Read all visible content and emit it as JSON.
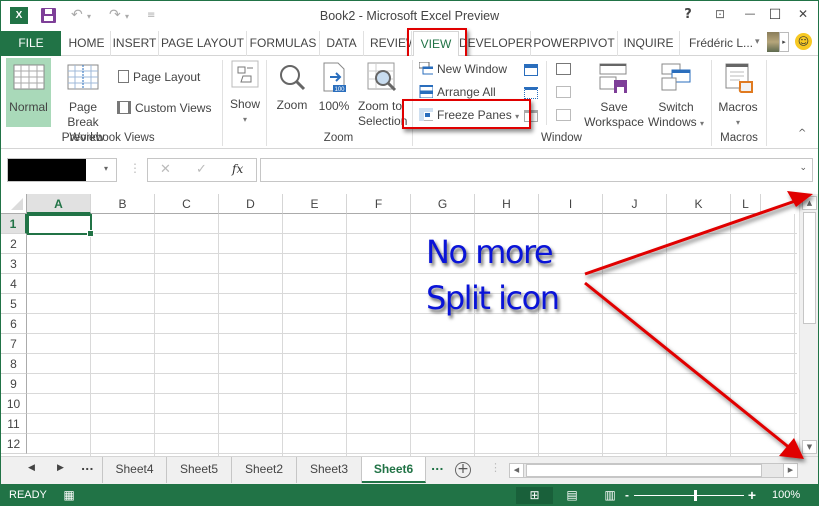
{
  "window": {
    "title": "Book2 - Microsoft Excel Preview",
    "app_icon": "excel-logo-icon",
    "qat": [
      "save-icon",
      "undo-icon",
      "redo-icon",
      "customize-qat-icon"
    ],
    "controls": {
      "help": "?",
      "restore_ribbon": "⊡",
      "minimize": "—",
      "maximize": "☐",
      "close": "✕"
    }
  },
  "tabs": {
    "file": "FILE",
    "items": [
      "HOME",
      "INSERT",
      "PAGE LAYOUT",
      "FORMULAS",
      "DATA",
      "REVIEW",
      "VIEW",
      "DEVELOPER",
      "POWERPIVOT",
      "INQUIRE"
    ],
    "active": "VIEW",
    "user": "Frédéric L...",
    "user_dropdown": "▾",
    "smiley": "☺"
  },
  "ribbon": {
    "workbook_views": {
      "label": "Workbook Views",
      "normal": "Normal",
      "page_break_1": "Page Break",
      "page_break_2": "Preview",
      "page_layout": "Page Layout",
      "custom_views": "Custom Views"
    },
    "show": {
      "label": "Show",
      "arrow": "▾"
    },
    "zoom": {
      "label": "Zoom",
      "zoom": "Zoom",
      "hundred": "100%",
      "hundred_badge": "100",
      "zoom_sel_1": "Zoom to",
      "zoom_sel_2": "Selection"
    },
    "window": {
      "label": "Window",
      "new_window": "New Window",
      "arrange_all": "Arrange All",
      "freeze_panes": "Freeze Panes",
      "freeze_arrow": "▾",
      "save_ws_1": "Save",
      "save_ws_2": "Workspace",
      "switch_1": "Switch",
      "switch_2": "Windows",
      "switch_arrow": "▾"
    },
    "macros": {
      "label": "Macros",
      "macros": "Macros",
      "arrow": "▾"
    },
    "collapse": "^"
  },
  "formula_bar": {
    "name_box_value": "",
    "name_dropdown": "▾",
    "cancel": "✕",
    "enter": "✓",
    "fx": "fx",
    "formula_value": "",
    "expand": "⌄"
  },
  "grid": {
    "columns": [
      "A",
      "B",
      "C",
      "D",
      "E",
      "F",
      "G",
      "H",
      "I",
      "J",
      "K",
      "L"
    ],
    "rows": [
      "1",
      "2",
      "3",
      "4",
      "5",
      "6",
      "7",
      "8",
      "9",
      "10",
      "11",
      "12"
    ],
    "active_cell": "A1"
  },
  "annotation": {
    "line1": "No more",
    "line2": "Split icon",
    "color": "#0a14d8",
    "arrow_color": "#e00000"
  },
  "sheets": {
    "nav_prev": "◀",
    "nav_next": "▶",
    "ellipsis": "...",
    "tabs": [
      "Sheet4",
      "Sheet5",
      "Sheet2",
      "Sheet3",
      "Sheet6"
    ],
    "active": "Sheet6",
    "add": "+"
  },
  "status": {
    "ready": "READY",
    "zoom_minus": "-",
    "zoom_plus": "+",
    "zoom_level": "100%",
    "zoom_fraction": 1.0
  },
  "colors": {
    "excel_green": "#217346",
    "selected_view": "#a9d9b9",
    "highlight_red": "#e00000"
  }
}
